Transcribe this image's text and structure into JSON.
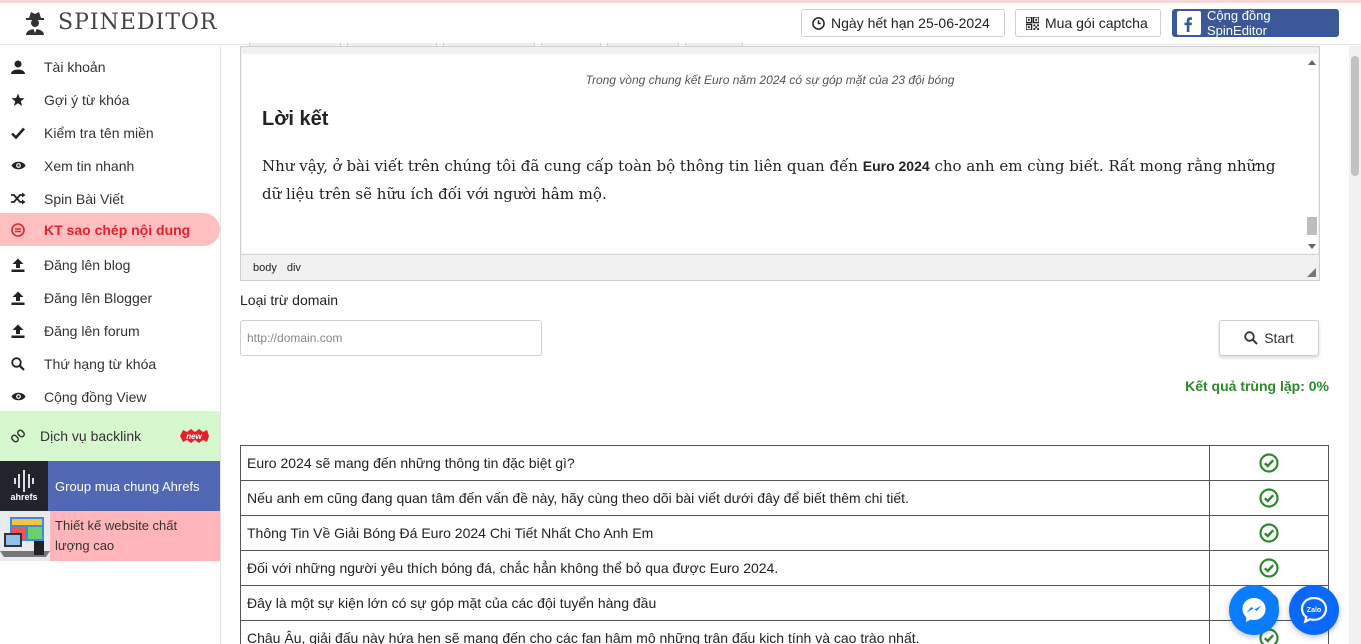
{
  "app": {
    "brand": "SPINEDITOR"
  },
  "header": {
    "expire_label": "Ngày hết hạn 25-06-2024",
    "captcha_label": "Mua gói captcha",
    "community_label": "Cộng đồng SpinEditor"
  },
  "sidebar": {
    "items": [
      {
        "label": "Tài khoản",
        "icon": "user-icon"
      },
      {
        "label": "Gợi ý từ khóa",
        "icon": "star-icon"
      },
      {
        "label": "Kiểm tra tên miền",
        "icon": "check-icon"
      },
      {
        "label": "Xem tin nhanh",
        "icon": "eye-icon"
      },
      {
        "label": "Spin Bài Viết",
        "icon": "shuffle-icon"
      },
      {
        "label": "KT sao chép nội dung",
        "icon": "copy-check-icon",
        "active": true
      },
      {
        "label": "Đăng lên blog",
        "icon": "upload-icon"
      },
      {
        "label": "Đăng lên Blogger",
        "icon": "upload-icon"
      },
      {
        "label": "Đăng lên forum",
        "icon": "upload-icon"
      },
      {
        "label": "Thứ hạng từ khóa",
        "icon": "search-icon"
      },
      {
        "label": "Cộng đồng View",
        "icon": "eye-icon"
      }
    ],
    "backlink": {
      "label": "Dịch vụ backlink",
      "badge": "new"
    },
    "promo_ahrefs": {
      "label": "Group mua chung Ahrefs",
      "thumb_text": "ahrefs"
    },
    "promo_web": {
      "label": "Thiết kế website chất lượng cao"
    }
  },
  "editor": {
    "caption": "Trong vòng chung kết Euro năm 2024 có sự góp mặt của 23 đội bóng",
    "heading": "Lời kết",
    "para_before": "Như vậy, ở bài viết trên chúng tôi đã cung cấp toàn bộ thông tin liên quan đến ",
    "para_bold": "Euro 2024",
    "para_after": " cho anh em cùng biết. Rất mong rằng những dữ liệu trên sẽ hữu ích đối với người hâm mộ.",
    "path": [
      "body",
      "div"
    ]
  },
  "form": {
    "exclude_label": "Loại trừ domain",
    "domain_placeholder": "http://domain.com",
    "start_label": "Start",
    "result": "Kết quả trùng lặp: 0%"
  },
  "results": [
    {
      "text": "Euro 2024 sẽ mang đến những thông tin đặc biệt gì?",
      "ok": true
    },
    {
      "text": "Nếu anh em cũng đang quan tâm đến vấn đề này, hãy cùng theo dõi bài viết dưới đây để biết thêm chi tiết.",
      "ok": true
    },
    {
      "text": "Thông Tin Về Giải Bóng Đá Euro 2024 Chi Tiết Nhất Cho Anh Em",
      "ok": true
    },
    {
      "text": "Đối với những người yêu thích bóng đá, chắc hẳn không thể bỏ qua được Euro 2024.",
      "ok": true
    },
    {
      "text": "Đây là một sự kiện lớn có sự góp mặt của các đội tuyển hàng đầu",
      "ok": true
    },
    {
      "text": "Châu Âu, giải đấu này hứa hẹn sẽ mang đến cho các fan hâm mộ những trận đấu kịch tính và cao trào nhất.",
      "ok": true
    }
  ],
  "colors": {
    "active_bg": "#ffbfc0",
    "active_text": "#e0232b",
    "ok_green": "#2c8a2c",
    "facebook": "#3b5998"
  },
  "chat": {
    "zalo_label": "Zalo"
  }
}
